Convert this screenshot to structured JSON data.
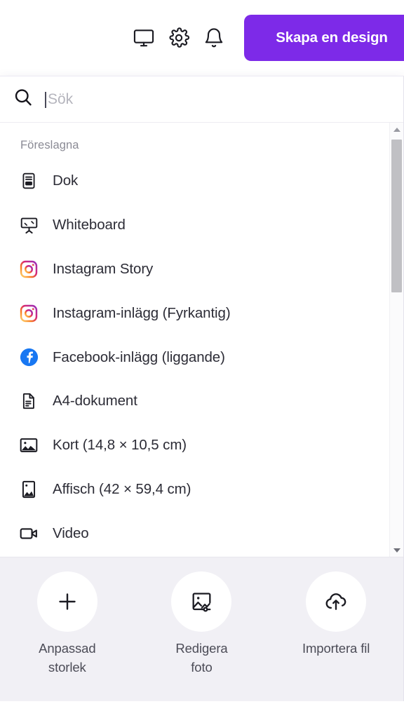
{
  "header": {
    "icons": [
      {
        "name": "display-icon",
        "label": "Display"
      },
      {
        "name": "settings-icon",
        "label": "Inställningar"
      },
      {
        "name": "notifications-icon",
        "label": "Aviseringar"
      }
    ],
    "create_button_label": "Skapa en design",
    "accent_color": "#7D2AE8"
  },
  "search": {
    "placeholder": "Sök",
    "value": "",
    "icon": "search-icon"
  },
  "suggestions": {
    "section_label": "Föreslagna",
    "items": [
      {
        "label": "Dok",
        "icon": "doc-icon"
      },
      {
        "label": "Whiteboard",
        "icon": "whiteboard-icon"
      },
      {
        "label": "Instagram Story",
        "icon": "instagram-icon"
      },
      {
        "label": "Instagram-inlägg (Fyrkantig)",
        "icon": "instagram-icon"
      },
      {
        "label": "Facebook-inlägg (liggande)",
        "icon": "facebook-icon"
      },
      {
        "label": "A4-dokument",
        "icon": "document-page-icon"
      },
      {
        "label": "Kort (14,8 × 10,5 cm)",
        "icon": "image-landscape-icon"
      },
      {
        "label": "Affisch (42 × 59,4 cm)",
        "icon": "image-portrait-icon"
      },
      {
        "label": "Video",
        "icon": "video-icon"
      }
    ]
  },
  "scrollbar": {
    "up_arrow": "scroll-up-arrow",
    "down_arrow": "scroll-down-arrow",
    "thumb": "scroll-thumb"
  },
  "footer": {
    "actions": [
      {
        "label": "Anpassad\nstorlek",
        "icon": "plus-icon"
      },
      {
        "label": "Redigera\nfoto",
        "icon": "photo-edit-icon"
      },
      {
        "label": "Importera fil",
        "icon": "cloud-upload-icon"
      }
    ]
  },
  "colors": {
    "brand_purple": "#7D2AE8",
    "facebook_blue": "#1877F2",
    "panel_bg": "#FFFFFF",
    "footer_bg": "#F1F0F5",
    "text_primary": "#2C2C36",
    "text_muted": "#8B8B95"
  }
}
